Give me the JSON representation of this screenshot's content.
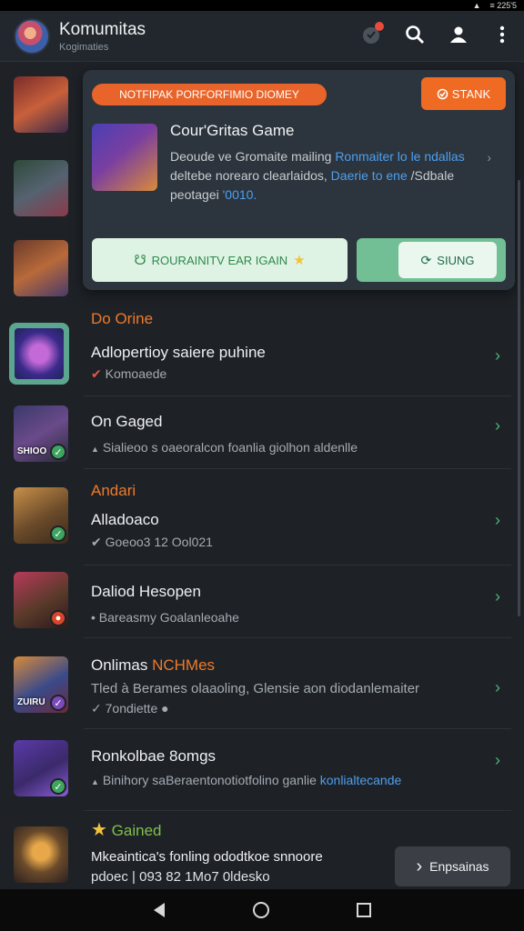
{
  "status_bar": {
    "battery": "≡ 225'5"
  },
  "app_bar": {
    "title": "Komumitas",
    "subtitle": "Kogimaties",
    "actions": [
      "notifications-icon",
      "search-icon",
      "profile-icon",
      "more-icon"
    ]
  },
  "featured": {
    "tag": "NOTFIPAK PORFORFIMIO DIOMEY",
    "start_button": "STANK",
    "title": "Cour'Gritas Game",
    "desc_line1": "Deoude ve Gromaite mailing ",
    "desc_line1_link": "Ronmaiter lo le ndallas",
    "desc_line2": "deltebe norearo clearlaidos, ",
    "desc_line2_link": "Daerie to ene",
    "desc_line2_end": " /Sdbale",
    "desc_line3": "peotagei ",
    "desc_line3_link": "'0010.",
    "primary_button": "ROURAINITV EAR IGAIN",
    "secondary_button": "SIUNG"
  },
  "sections": {
    "online": "Do Orine",
    "andari": "Andari"
  },
  "list": [
    {
      "title": "Adlopertioy saiere puhine",
      "sub": "Komoaede",
      "sub_icon": "check-red-icon"
    },
    {
      "title": "On Gaged",
      "sub": "Sialieoo s oaeoralcon foanlia giolhon aldenlle",
      "sub_icon": "triangle-icon"
    },
    {
      "title": "Alladoaco",
      "sub": "Goeoo3 12 Ool021",
      "sub_icon": "check-white-icon"
    },
    {
      "title": "Daliod Hesopen",
      "sub": "Bareasmy Goalanleoahe",
      "sub_icon": "dot-icon"
    },
    {
      "title_plain": "Onlimas ",
      "title_highlight": "NCHMes",
      "sub": "Tled à Berames olaaoling, Glensie aon diodanlemaiter",
      "sub2": "7ondiette",
      "sub2_icon": "check-white-icon"
    },
    {
      "title": "Ronkolbae 8omgs",
      "sub_plain": "Binihory saBeraentonotiotfolino ganlie ",
      "sub_link": "konlialtecande",
      "sub_icon": "triangle-icon"
    },
    {
      "section": "Gained",
      "title": "Mkeaintica's fonling ododtkoe snnoore",
      "sub": "pdoec | 093 82 1Mo7 0ldesko"
    }
  ],
  "thumbnails": [
    {
      "label": ""
    },
    {
      "label": ""
    },
    {
      "label": ""
    },
    {
      "label": ""
    },
    {
      "label": "SHIOO"
    },
    {
      "label": ""
    },
    {
      "label": ""
    },
    {
      "label": "ZUIRU"
    },
    {
      "label": ""
    },
    {
      "label": ""
    }
  ],
  "fab": {
    "label": "Enpsainas"
  },
  "colors": {
    "accent_orange": "#ee7a2a",
    "accent_green": "#4fb27a",
    "link_blue": "#4d9ff0",
    "background": "#1e2227"
  }
}
